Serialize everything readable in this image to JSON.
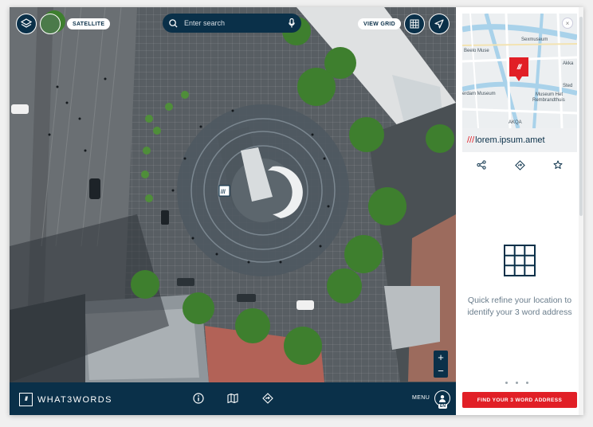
{
  "map": {
    "satellite_label": "SATELLITE",
    "view_grid_label": "VIEW GRID",
    "search_placeholder": "Enter search",
    "zoom_in": "+",
    "zoom_out": "−"
  },
  "bottombar": {
    "logo_mark": "///",
    "logo_text": "WHAT3WORDS",
    "menu_label": "MENU",
    "language": "EN"
  },
  "panel": {
    "minimap_labels": [
      "Sexmuseum",
      "Beelo Muse",
      "Museum Het",
      "Rembrandthuis",
      "Akka",
      "erdam Museum",
      "AKQA",
      "Sted"
    ],
    "pin_mark": "///",
    "close_label": "×",
    "address_prefix": "///",
    "address": "lorem.ipsum.amet",
    "refine_text": "Quick refine your location to identify your 3 word address",
    "cta_label": "FIND YOUR 3 WORD ADDRESS"
  },
  "colors": {
    "navy": "#0a3049",
    "red": "#e11f26"
  }
}
